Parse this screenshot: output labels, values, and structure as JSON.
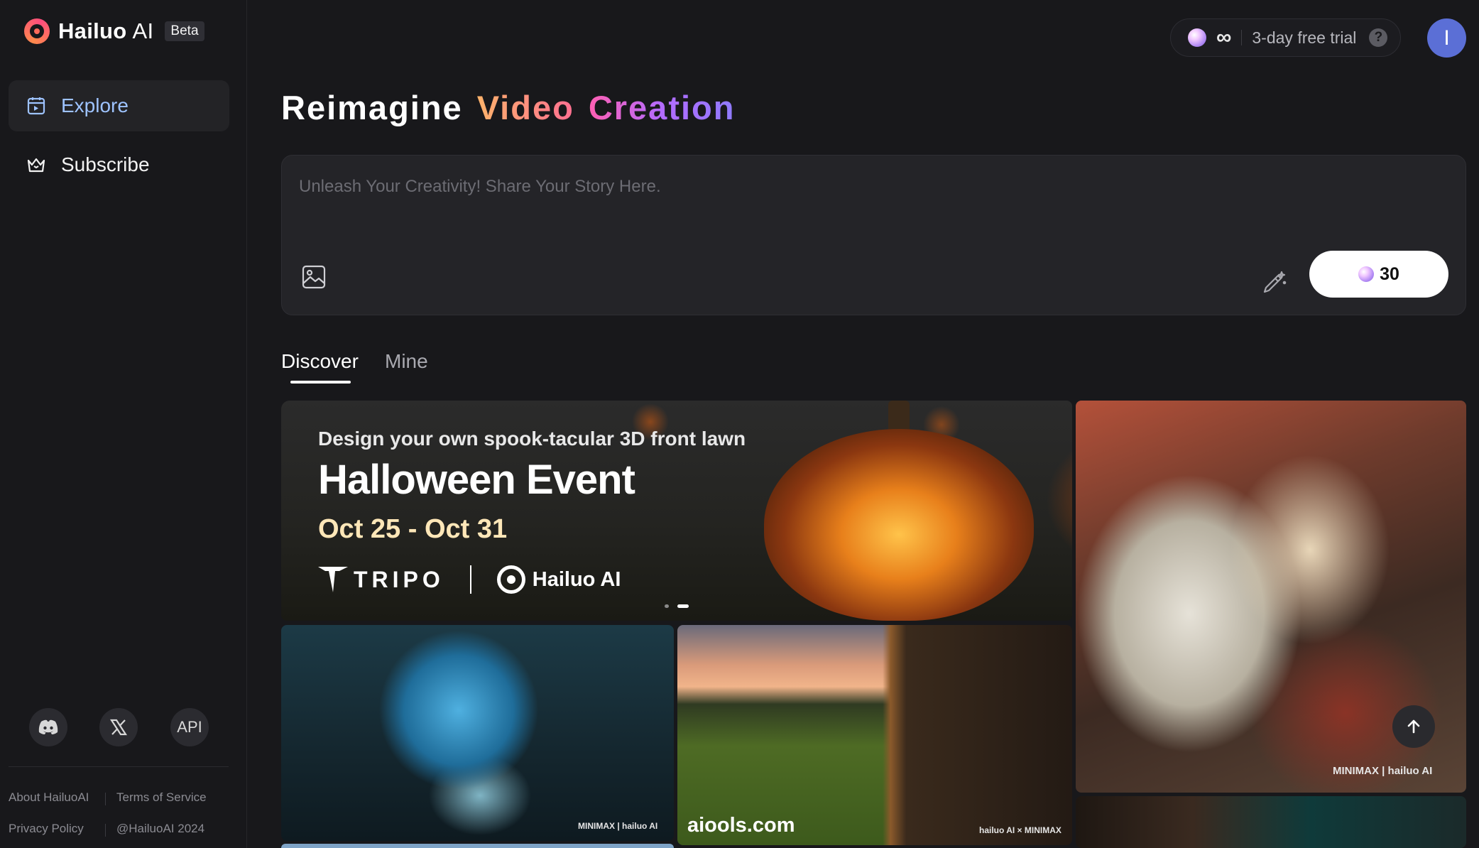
{
  "app": {
    "logo_name": "Hailuo",
    "logo_suffix": "AI",
    "badge": "Beta"
  },
  "sidebar": {
    "items": [
      {
        "label": "Explore",
        "icon": "calendar-play-icon",
        "active": true
      },
      {
        "label": "Subscribe",
        "icon": "crown-icon",
        "active": false
      }
    ],
    "social": [
      {
        "icon": "discord-icon"
      },
      {
        "icon": "x-icon"
      },
      {
        "label": "API"
      }
    ],
    "footer": {
      "about": "About HailuoAI",
      "terms": "Terms of Service",
      "privacy": "Privacy Policy",
      "copyright": "@HailuoAI 2024"
    }
  },
  "topbar": {
    "credits": "∞",
    "trial_text": "3-day free trial",
    "help": "?",
    "avatar_initial": "I"
  },
  "headline": {
    "word1": "Reimagine",
    "word2": "Video",
    "word3": "Creation"
  },
  "prompt": {
    "placeholder": "Unleash Your Creativity! Share Your Story Here.",
    "value": "",
    "cost": "30"
  },
  "tabs": [
    {
      "label": "Discover",
      "active": true
    },
    {
      "label": "Mine",
      "active": false
    }
  ],
  "banner": {
    "subtitle": "Design your own spook-tacular 3D front lawn",
    "title": "Halloween Event",
    "date": "Oct 25 - Oct 31",
    "brand1": "TRIPO",
    "brand2": "Hailuo AI",
    "slide_count": 2,
    "active_slide": 2
  },
  "cards": {
    "dragon_watermark": "MINIMAX | hailuo AI",
    "monster_watermark": "MINIMAX | hailuo AI",
    "field_watermark": "hailuo AI × MINIMAX",
    "field_site": "aiools.com"
  },
  "colors": {
    "background": "#18181b",
    "accent_blue": "#9ec3ff",
    "video_gradient": [
      "#ffb36b",
      "#ff6f91"
    ],
    "creation_gradient": [
      "#ff5fb2",
      "#b36bff",
      "#8f7bff"
    ]
  }
}
